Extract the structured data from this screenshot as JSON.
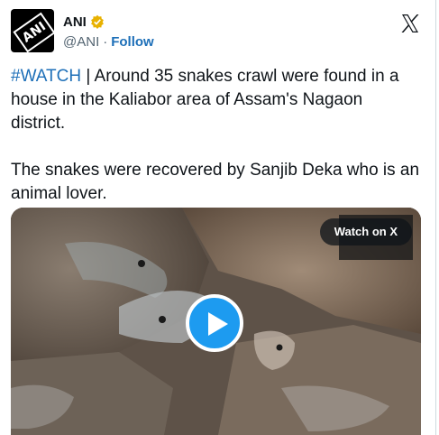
{
  "header": {
    "name": "ANI",
    "handle": "@ANI",
    "separator": "·",
    "follow_label": "Follow",
    "avatar_icon": "ani-logo-icon",
    "verified_icon": "gold-verified-badge-icon",
    "close_icon": "x-logo-icon"
  },
  "tweet": {
    "hashtag": "#WATCH",
    "line1_rest": " | Around 35 snakes crawl were found in a house in the Kaliabor area of Assam's Nagaon district.",
    "line2": "The snakes were recovered by Sanjib Deka who is an animal lover."
  },
  "media": {
    "watch_label": "Watch on X",
    "play_icon": "play-icon"
  },
  "colors": {
    "link": "#1d6fb8",
    "play_button": "#1d9bf0",
    "verified": "#e8b100"
  }
}
